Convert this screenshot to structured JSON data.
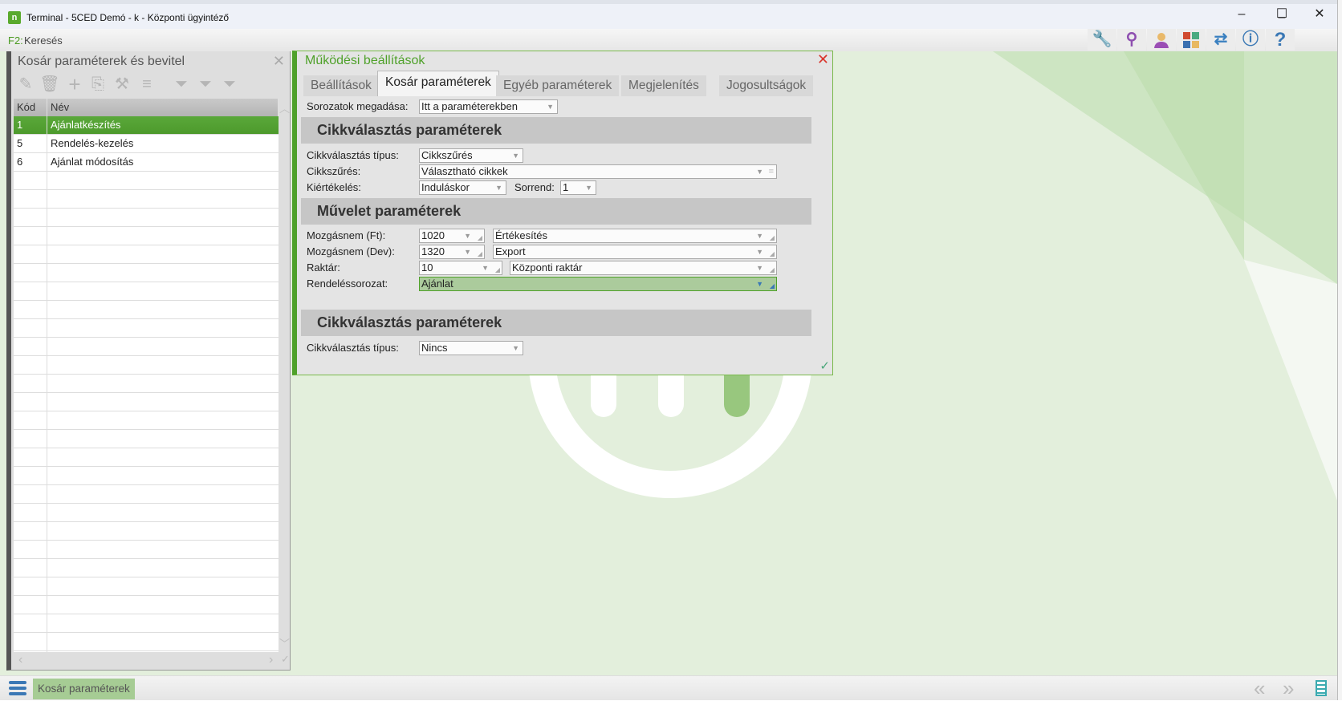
{
  "window": {
    "title": "Terminal - 5CED Demó - k - Központi ügyintéző",
    "app_icon": "n",
    "minimize": "–",
    "maximize": "☐",
    "close": "✕"
  },
  "searchbar": {
    "key": "F2:",
    "label": "Keresés"
  },
  "toolbar_icons": [
    "wrench-icon",
    "search-icon",
    "user-icon",
    "modules-icon",
    "transfer-icon",
    "info-icon",
    "help-icon"
  ],
  "left_panel": {
    "title": "Kosár paraméterek és bevitel",
    "columns": [
      "Kód",
      "Név"
    ],
    "rows": [
      {
        "code": "1",
        "name": "Ajánlatkészítés",
        "selected": true
      },
      {
        "code": "5",
        "name": "Rendelés-kezelés"
      },
      {
        "code": "6",
        "name": "Ajánlat módosítás"
      }
    ],
    "tools": [
      "edit-icon",
      "delete-icon",
      "add-icon",
      "copy-icon",
      "tools-icon",
      "list-icon",
      "filter-icon",
      "clear-filter-icon",
      "filter-add-icon"
    ]
  },
  "dialog": {
    "title": "Működési beállítások",
    "tabs": [
      "Beállítások",
      "Kosár paraméterek",
      "Egyéb paraméterek",
      "Megjelenítés",
      "Jogosultságok"
    ],
    "active_tab": 1,
    "sorozatok_label": "Sorozatok megadása:",
    "sorozatok_value": "Itt a paraméterekben",
    "section1": "Cikkválasztás paraméterek",
    "cikk_tipus_label": "Cikkválasztás típus:",
    "cikk_tipus_value": "Cikkszűrés",
    "cikkszures_label": "Cikkszűrés:",
    "cikkszures_value": "Választható cikkek",
    "kiert_label": "Kiértékelés:",
    "kiert_value": "Induláskor",
    "sorrend_label": "Sorrend:",
    "sorrend_value": "1",
    "section2": "Művelet paraméterek",
    "mozg_ft_label": "Mozgásnem (Ft):",
    "mozg_ft_code": "1020",
    "mozg_ft_name": "Értékesítés",
    "mozg_dev_label": "Mozgásnem (Dev):",
    "mozg_dev_code": "1320",
    "mozg_dev_name": "Export",
    "raktar_label": "Raktár:",
    "raktar_code": "10",
    "raktar_name": "Központi raktár",
    "rend_label": "Rendeléssorozat:",
    "rend_value": "Ajánlat",
    "section3": "Cikkválasztás paraméterek",
    "cikk_tipus2_label": "Cikkválasztás típus:",
    "cikk_tipus2_value": "Nincs"
  },
  "bottom": {
    "tab": "Kosár paraméterek"
  },
  "colors": {
    "accent": "#4fa12a",
    "selected_row": "#5aa83a",
    "background": "#e3efdc"
  }
}
